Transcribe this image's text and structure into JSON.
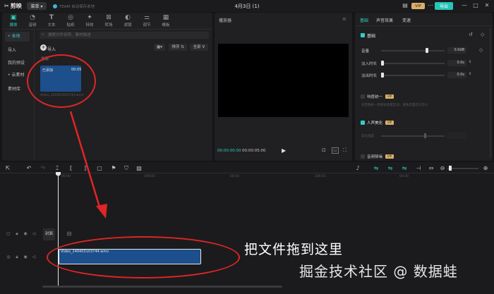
{
  "titlebar": {
    "brand": "剪映",
    "menu_label": "菜单 ▾",
    "tip_text": "TEAM 自动保存本地",
    "doc_title": "4月3日 (1)",
    "vip_label": "VIP",
    "export_label": "导出"
  },
  "toolbar": [
    {
      "label": "媒体",
      "icon": "media-icon"
    },
    {
      "label": "音频",
      "icon": "audio-icon"
    },
    {
      "label": "文本",
      "icon": "text-icon"
    },
    {
      "label": "贴纸",
      "icon": "sticker-icon"
    },
    {
      "label": "特效",
      "icon": "effects-icon"
    },
    {
      "label": "转场",
      "icon": "transition-icon"
    },
    {
      "label": "滤镜",
      "icon": "filter-icon"
    },
    {
      "label": "调节",
      "icon": "adjust-icon"
    },
    {
      "label": "模板",
      "icon": "template-icon"
    }
  ],
  "media_nav": [
    {
      "label": "• 本地",
      "selected": true
    },
    {
      "label": "导入",
      "selected": false
    },
    {
      "label": "我的预设",
      "selected": false
    },
    {
      "label": "• 云素材",
      "selected": false
    },
    {
      "label": "素材库",
      "selected": false
    }
  ],
  "media": {
    "search_placeholder": "搜索文件名称、素材描述",
    "import_label": "导入",
    "sort_label": "排序",
    "filter_label": "全部",
    "all_label": "全部",
    "clip": {
      "tag": "已添加",
      "duration": "00:05",
      "name": "Video_240403103744.wmv"
    }
  },
  "player": {
    "title": "播放器",
    "time_current": "00:00:00:00",
    "time_total": "00:00:05:00"
  },
  "inspector": {
    "tabs": [
      "基础",
      "声音效果",
      "变速"
    ],
    "section_basic": "基础",
    "volume_label": "音量",
    "volume_value": "0.0dB",
    "fade_in_label": "淡入时长",
    "fade_in_value": "0.0s",
    "fade_out_label": "淡出时长",
    "fade_out_value": "0.0s",
    "normalize_label": "响度统一",
    "normalize_desc": "对音频统一到目标响度区间，避免音量忽大忽小",
    "voice_enhance_label": "人声美化",
    "voice_enhance_sub": "美化强度",
    "noise_reduce_label": "音频降噪",
    "badge_vip": "VIP"
  },
  "timeline": {
    "ruler": [
      "00:00",
      "100:05",
      "00:10",
      "100:15",
      "00:20"
    ],
    "cover_label": "封面",
    "clip_name": "Video_240403103744.wmv"
  },
  "annotation": {
    "instruction": "把文件拖到这里",
    "color": "#e02525"
  },
  "watermark": "掘金技术社区 @ 数据蛙",
  "colors": {
    "accent": "#2fd0c0",
    "clip_blue": "#1c4f8c",
    "background": "#151517"
  }
}
